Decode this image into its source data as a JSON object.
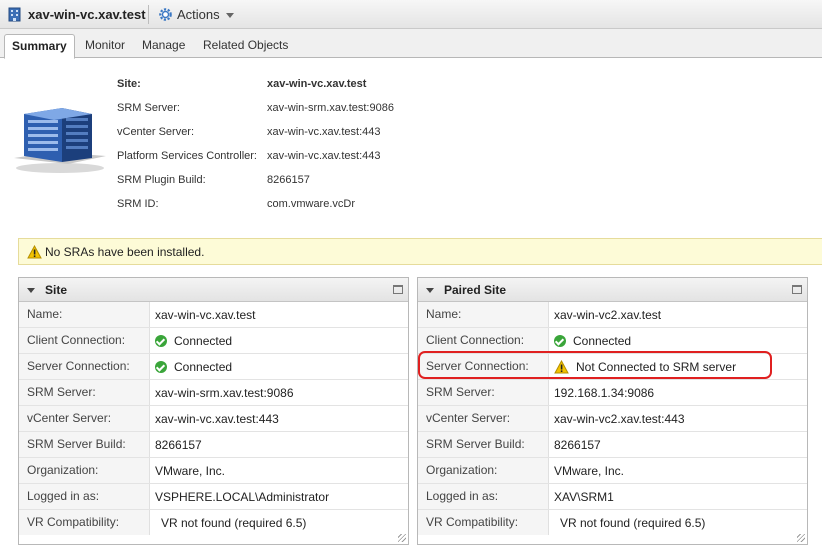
{
  "window": {
    "title": "xav-win-vc.xav.test",
    "actions_label": "Actions"
  },
  "tabs": [
    {
      "label": "Summary",
      "active": true
    },
    {
      "label": "Monitor",
      "active": false
    },
    {
      "label": "Manage",
      "active": false
    },
    {
      "label": "Related Objects",
      "active": false
    }
  ],
  "summary": {
    "icon": "datacenter-building-icon",
    "rows": [
      {
        "label": "Site:",
        "value": "xav-win-vc.xav.test"
      },
      {
        "label": "SRM Server:",
        "value": "xav-win-srm.xav.test:9086"
      },
      {
        "label": "vCenter Server:",
        "value": "xav-win-vc.xav.test:443"
      },
      {
        "label": "Platform Services Controller:",
        "value": "xav-win-vc.xav.test:443"
      },
      {
        "label": "SRM Plugin Build:",
        "value": "8266157"
      },
      {
        "label": "SRM ID:",
        "value": "com.vmware.vcDr"
      }
    ]
  },
  "warning": {
    "text": "No SRAs have been installed."
  },
  "site_panel": {
    "title": "Site",
    "rows": [
      {
        "label": "Name:",
        "value": "xav-win-vc.xav.test"
      },
      {
        "label": "Client Connection:",
        "value": "Connected",
        "icon": "ok"
      },
      {
        "label": "Server Connection:",
        "value": "Connected",
        "icon": "ok"
      },
      {
        "label": "SRM Server:",
        "value": "xav-win-srm.xav.test:9086"
      },
      {
        "label": "vCenter Server:",
        "value": "xav-win-vc.xav.test:443"
      },
      {
        "label": "SRM Server Build:",
        "value": "8266157"
      },
      {
        "label": "Organization:",
        "value": "VMware, Inc."
      },
      {
        "label": "Logged in as:",
        "value": "VSPHERE.LOCAL\\Administrator"
      },
      {
        "label": "VR Compatibility:",
        "value": "VR not found (required 6.5)"
      }
    ]
  },
  "paired_panel": {
    "title": "Paired Site",
    "rows": [
      {
        "label": "Name:",
        "value": "xav-win-vc2.xav.test"
      },
      {
        "label": "Client Connection:",
        "value": "Connected",
        "icon": "ok"
      },
      {
        "label": "Server Connection:",
        "value": "Not Connected to SRM server",
        "icon": "warning"
      },
      {
        "label": "SRM Server:",
        "value": "192.168.1.34:9086"
      },
      {
        "label": "vCenter Server:",
        "value": "xav-win-vc2.xav.test:443"
      },
      {
        "label": "SRM Server Build:",
        "value": "8266157"
      },
      {
        "label": "Organization:",
        "value": "VMware, Inc."
      },
      {
        "label": "Logged in as:",
        "value": "XAV\\SRM1"
      },
      {
        "label": "VR Compatibility:",
        "value": "VR not found (required 6.5)"
      }
    ]
  },
  "colors": {
    "ok": "#3aa53a",
    "warning": "#f2c200",
    "highlight": "#e02020",
    "warning_bar": "#fdfbd7"
  }
}
